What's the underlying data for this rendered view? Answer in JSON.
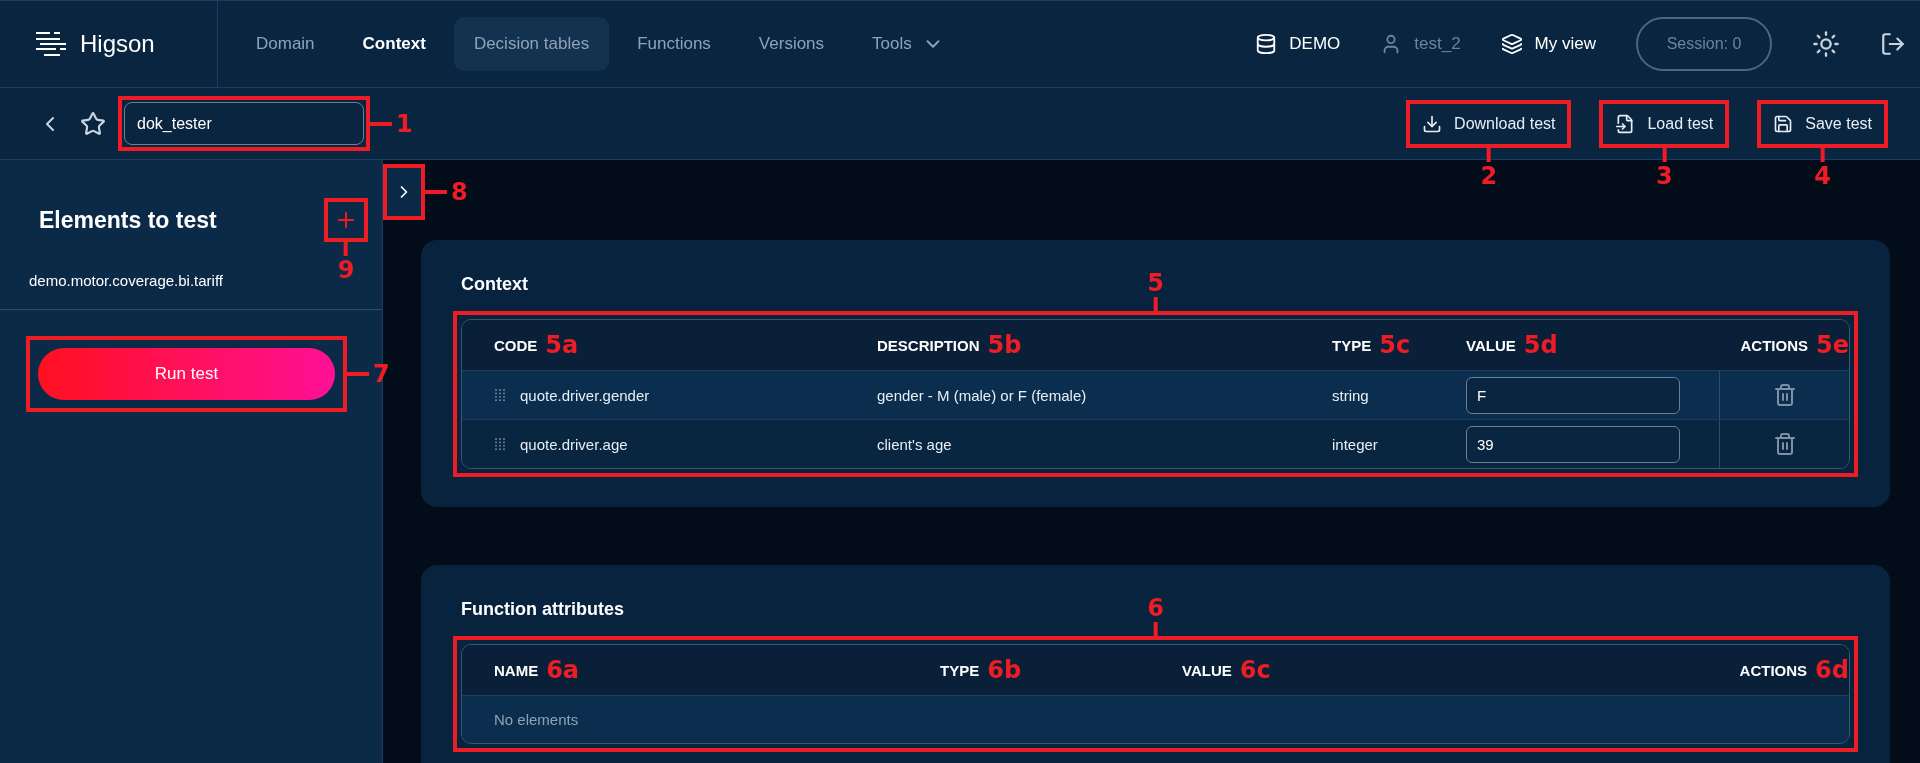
{
  "brand": "Higson",
  "nav": [
    {
      "label": "Domain",
      "selected": false,
      "highlighted": false
    },
    {
      "label": "Context",
      "selected": true,
      "highlighted": false
    },
    {
      "label": "Decision tables",
      "selected": false,
      "highlighted": true
    },
    {
      "label": "Functions",
      "selected": false,
      "highlighted": false
    },
    {
      "label": "Versions",
      "selected": false,
      "highlighted": false
    },
    {
      "label": "Tools",
      "selected": false,
      "highlighted": false,
      "dropdown": true
    }
  ],
  "header_right": {
    "environment": "DEMO",
    "user": "test_2",
    "view": "My view",
    "session": "Session: 0"
  },
  "toolbar": {
    "name_field": {
      "value": "dok_tester",
      "annotation": "1"
    },
    "buttons": [
      {
        "kind": "download",
        "label": "Download test",
        "annotation": "2"
      },
      {
        "kind": "load",
        "label": "Load test",
        "annotation": "3"
      },
      {
        "kind": "save",
        "label": "Save test",
        "annotation": "4"
      }
    ]
  },
  "sidebar": {
    "title": "Elements to test",
    "add_annotation": "9",
    "items": [
      "demo.motor.coverage.bi.tariff"
    ],
    "run_button": {
      "label": "Run test",
      "annotation": "7"
    },
    "collapse_annotation": "8"
  },
  "context": {
    "title": "Context",
    "annotation": "5",
    "columns": [
      {
        "label": "CODE",
        "annotation": "5a"
      },
      {
        "label": "DESCRIPTION",
        "annotation": "5b"
      },
      {
        "label": "TYPE",
        "annotation": "5c"
      },
      {
        "label": "VALUE",
        "annotation": "5d"
      },
      {
        "label": "ACTIONS",
        "annotation": "5e"
      }
    ],
    "rows": [
      {
        "code": "quote.driver.gender",
        "description": "gender - M (male) or F (female)",
        "type": "string",
        "value": "F"
      },
      {
        "code": "quote.driver.age",
        "description": "client's age",
        "type": "integer",
        "value": "39"
      }
    ]
  },
  "function_attributes": {
    "title": "Function attributes",
    "annotation": "6",
    "columns": [
      {
        "label": "NAME",
        "annotation": "6a"
      },
      {
        "label": "TYPE",
        "annotation": "6b"
      },
      {
        "label": "VALUE",
        "annotation": "6c"
      },
      {
        "label": "ACTIONS",
        "annotation": "6d"
      }
    ],
    "empty": "No elements"
  }
}
